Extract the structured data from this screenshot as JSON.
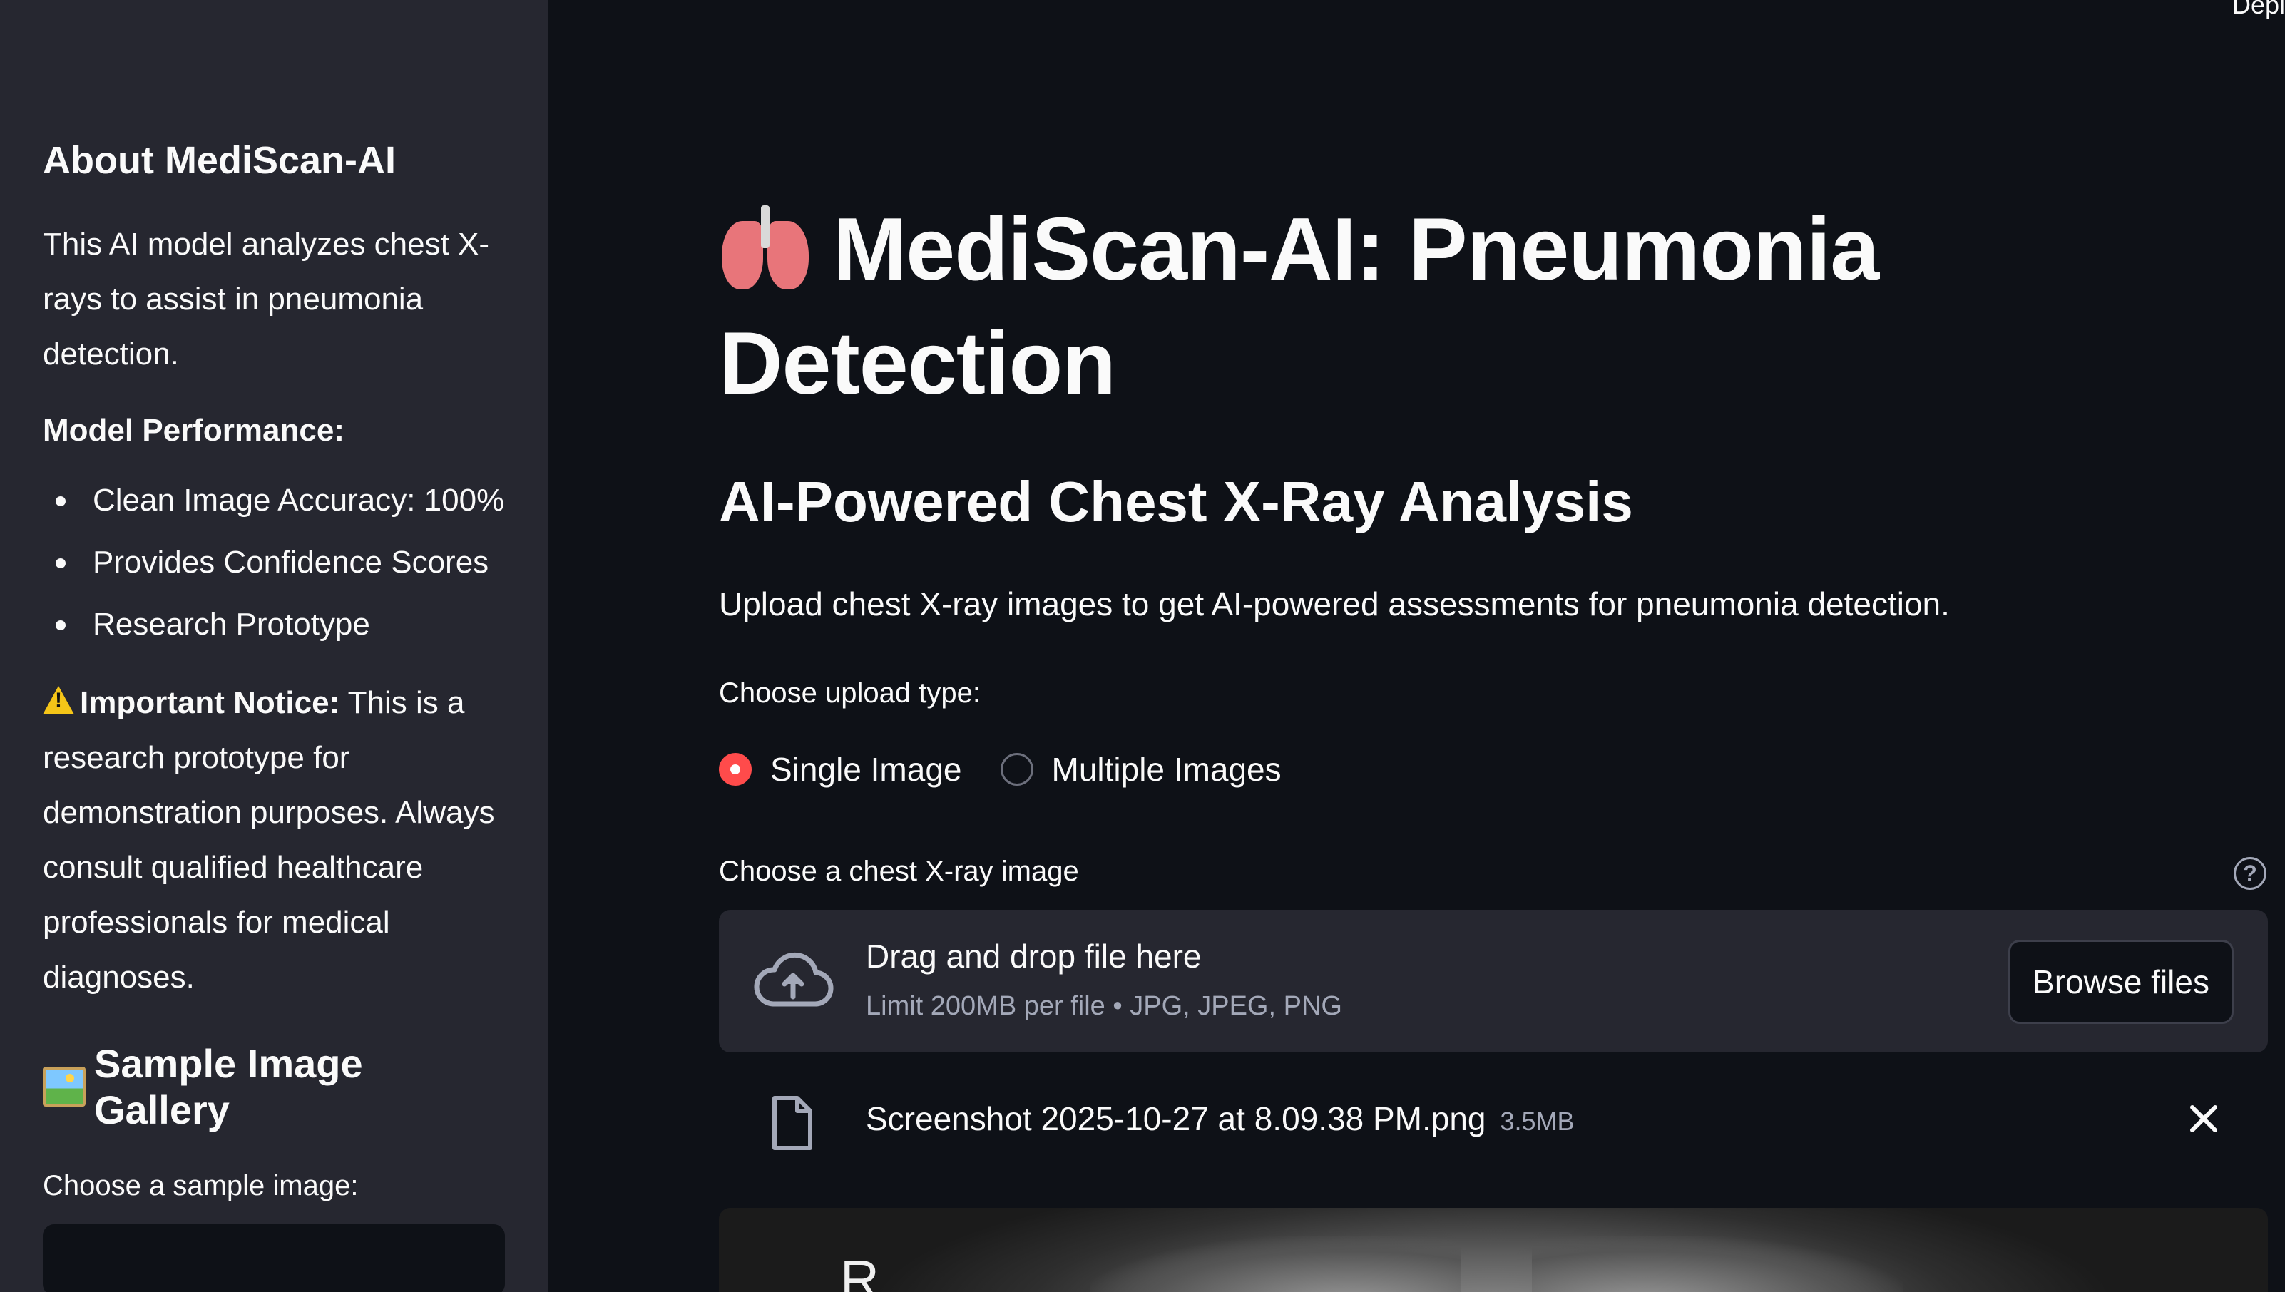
{
  "top_right": {
    "label": "Depl"
  },
  "sidebar": {
    "about_title": "About MediScan-AI",
    "intro": "This AI model analyzes chest X-rays to assist in pneumonia detection.",
    "performance_title": "Model Performance:",
    "performance_items": [
      "Clean Image Accuracy: 100%",
      "Provides Confidence Scores",
      "Research Prototype"
    ],
    "notice_label": "Important Notice:",
    "notice_text": " This is a research prototype for demonstration purposes. Always consult qualified healthcare professionals for medical diagnoses.",
    "gallery_title": "Sample Image Gallery",
    "sample_label": "Choose a sample image:"
  },
  "main": {
    "title": "MediScan-AI: Pneumonia Detection",
    "subtitle": "AI-Powered Chest X-Ray Analysis",
    "description": "Upload chest X-ray images to get AI-powered assessments for pneumonia detection.",
    "upload_type_label": "Choose upload type:",
    "upload_options": [
      {
        "label": "Single Image",
        "selected": true
      },
      {
        "label": "Multiple Images",
        "selected": false
      }
    ],
    "uploader_label": "Choose a chest X-ray image",
    "help_glyph": "?",
    "dropzone_title": "Drag and drop file here",
    "dropzone_limit": "Limit 200MB per file • JPG, JPEG, PNG",
    "browse_label": "Browse files",
    "file_name": "Screenshot 2025-10-27 at 8.09.38 PM.png",
    "file_size": "3.5MB",
    "xray_marker": "R"
  },
  "colors": {
    "accent": "#ff4b4b",
    "background": "#0e1117",
    "sidebar": "#262730"
  },
  "icons": [
    "lungs-icon",
    "warning-icon",
    "picture-icon",
    "upload-cloud-icon",
    "file-icon",
    "close-icon",
    "help-icon"
  ]
}
